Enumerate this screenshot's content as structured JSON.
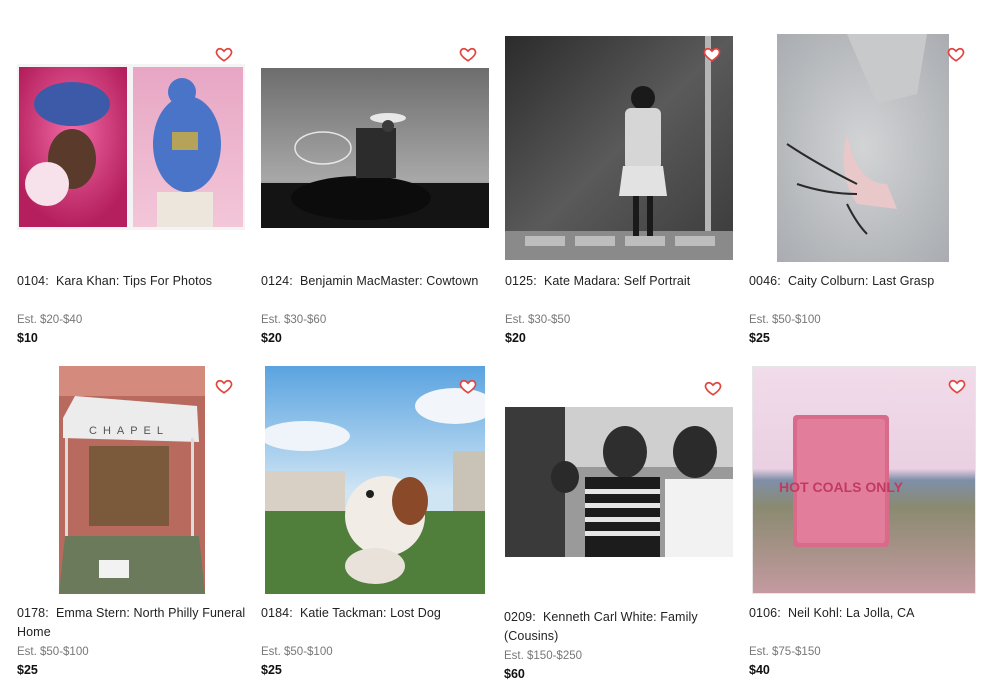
{
  "lots": [
    {
      "number": "0104:",
      "title": "Kara Khan: Tips For Photos",
      "estimate": "Est. $20-$40",
      "price": "$10",
      "favorite_icon": "heart-outline-icon"
    },
    {
      "number": "0124:",
      "title": "Benjamin MacMaster: Cowtown",
      "estimate": "Est. $30-$60",
      "price": "$20",
      "favorite_icon": "heart-outline-icon"
    },
    {
      "number": "0125:",
      "title": "Kate Madara: Self Portrait",
      "estimate": "Est. $30-$50",
      "price": "$20",
      "favorite_icon": "heart-outline-icon"
    },
    {
      "number": "0046:",
      "title": "Caity Colburn: Last Grasp",
      "estimate": "Est. $50-$100",
      "price": "$25",
      "favorite_icon": "heart-outline-icon"
    },
    {
      "number": "0178:",
      "title": "Emma Stern: North Philly Funeral Home",
      "estimate": "Est. $50-$100",
      "price": "$25",
      "favorite_icon": "heart-outline-icon",
      "sign_text": "CHAPEL"
    },
    {
      "number": "0184:",
      "title": "Katie Tackman: Lost Dog",
      "estimate": "Est. $50-$100",
      "price": "$25",
      "favorite_icon": "heart-outline-icon"
    },
    {
      "number": "0209:",
      "title": "Kenneth Carl White: Family (Cousins)",
      "estimate": "Est. $150-$250",
      "price": "$60",
      "favorite_icon": "heart-outline-icon"
    },
    {
      "number": "0106:",
      "title": "Neil Kohl: La Jolla, CA",
      "estimate": "Est. $75-$150",
      "price": "$40",
      "favorite_icon": "heart-outline-icon",
      "sign_text": "HOT COALS ONLY"
    }
  ],
  "colors": {
    "heart": "#e0453f",
    "estimate": "#777777",
    "price": "#111111"
  }
}
